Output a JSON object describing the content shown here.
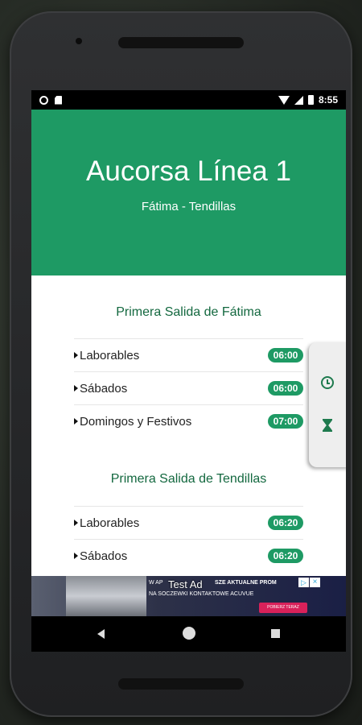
{
  "status_bar": {
    "time": "8:55"
  },
  "header": {
    "title": "Aucorsa Línea 1",
    "subtitle": "Fátima - Tendillas"
  },
  "sections": [
    {
      "title": "Primera Salida de Fátima",
      "rows": [
        {
          "label": "Laborables",
          "time": "06:00"
        },
        {
          "label": "Sábados",
          "time": "06:00"
        },
        {
          "label": "Domingos y Festivos",
          "time": "07:00"
        }
      ]
    },
    {
      "title": "Primera Salida de Tendillas",
      "rows": [
        {
          "label": "Laborables",
          "time": "06:20"
        },
        {
          "label": "Sábados",
          "time": "06:20"
        }
      ]
    }
  ],
  "ad": {
    "label": "Test Ad",
    "line1": "W AP",
    "line1b": "SZE AKTUALNE PROM",
    "line2": "NA SOCZEWKI KONTAKTOWE ACUVUE",
    "cta": "POBIERZ TERAZ",
    "choices_glyph": "▷",
    "close_glyph": "×"
  },
  "colors": {
    "primary": "#1e9a64",
    "section_title": "#13683f"
  }
}
